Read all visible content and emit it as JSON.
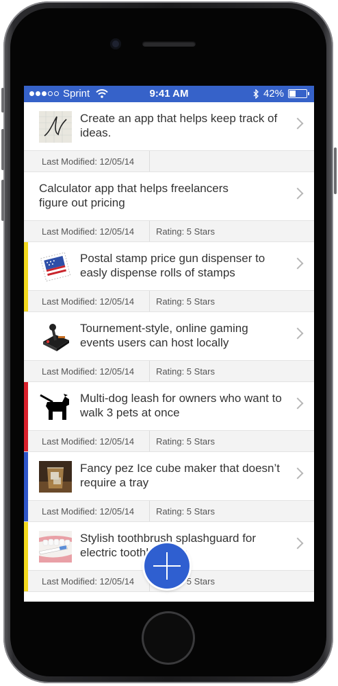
{
  "status": {
    "carrier": "Sprint",
    "time": "9:41 AM",
    "battery": "42%",
    "battery_level": 0.42
  },
  "ideas": [
    {
      "title": "Create an app that helps keep track of ideas.",
      "modified": "Last Modified: 12/05/14",
      "rating": "",
      "strip": "",
      "image": "handwriting-thumbnail"
    },
    {
      "title": "Calculator app that helps freelancers figure out pricing",
      "modified": "Last Modified: 12/05/14",
      "rating": "Rating: 5 Stars",
      "strip": "",
      "image": ""
    },
    {
      "title": "Postal stamp price gun dispenser to easly dispense rolls of stamps",
      "modified": "Last Modified: 12/05/14",
      "rating": "Rating: 5 Stars",
      "strip": "#f2d81f",
      "image": "stamp-thumbnail"
    },
    {
      "title": "Tournement-style, online gaming events users can host locally",
      "modified": "Last Modified: 12/05/14",
      "rating": "Rating: 5 Stars",
      "strip": "",
      "image": "joystick-thumbnail"
    },
    {
      "title": "Multi-dog leash for owners who want to walk 3 pets at once",
      "modified": "Last Modified: 12/05/14",
      "rating": "Rating: 5 Stars",
      "strip": "#d8202c",
      "image": "dog-icon"
    },
    {
      "title": "Fancy pez Ice cube maker that doesn’t require a tray",
      "modified": "Last Modified: 12/05/14",
      "rating": "Rating: 5 Stars",
      "strip": "#2e55c9",
      "image": "ice-glass-thumbnail"
    },
    {
      "title": "Stylish toothbrush splashguard for electric toothbrushes",
      "modified": "Last Modified: 12/05/14",
      "rating": "Rating: 5 Stars",
      "strip": "#f2d81f",
      "image": "toothbrush-thumbnail"
    }
  ],
  "fab": {
    "icon": "plus-icon"
  },
  "colors": {
    "accent": "#3662c9",
    "fab": "#2f5fd0"
  }
}
